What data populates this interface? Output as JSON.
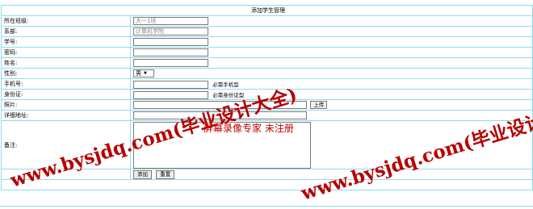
{
  "form": {
    "title": "添加学生管理",
    "fields": {
      "class": {
        "label": "所在班级:",
        "value": "大一1班"
      },
      "dept": {
        "label": "系部:",
        "value": "计算机学院"
      },
      "student_no": {
        "label": "学号:",
        "value": ""
      },
      "password": {
        "label": "密码:",
        "value": ""
      },
      "name": {
        "label": "姓名:",
        "value": ""
      },
      "gender": {
        "label": "性别:",
        "value": "男"
      },
      "phone": {
        "label": "手机号:",
        "value": "",
        "hint": "必需手机型"
      },
      "id_card": {
        "label": "身份证:",
        "value": "",
        "hint": "必需身份证型"
      },
      "photo": {
        "label": "照片:",
        "value": "",
        "upload_label": "上传"
      },
      "address": {
        "label": "详细地址:",
        "value": ""
      },
      "note": {
        "label": "备注:",
        "value": ""
      }
    },
    "buttons": {
      "add": "添加",
      "reset": "重置"
    }
  },
  "watermarks": {
    "site_text": "www.bysjdq.com(毕业设计大全)",
    "recorder_text": "屏幕录像专家 未注册",
    "color": "#b40000"
  },
  "colors": {
    "border": "#8fdcec"
  }
}
